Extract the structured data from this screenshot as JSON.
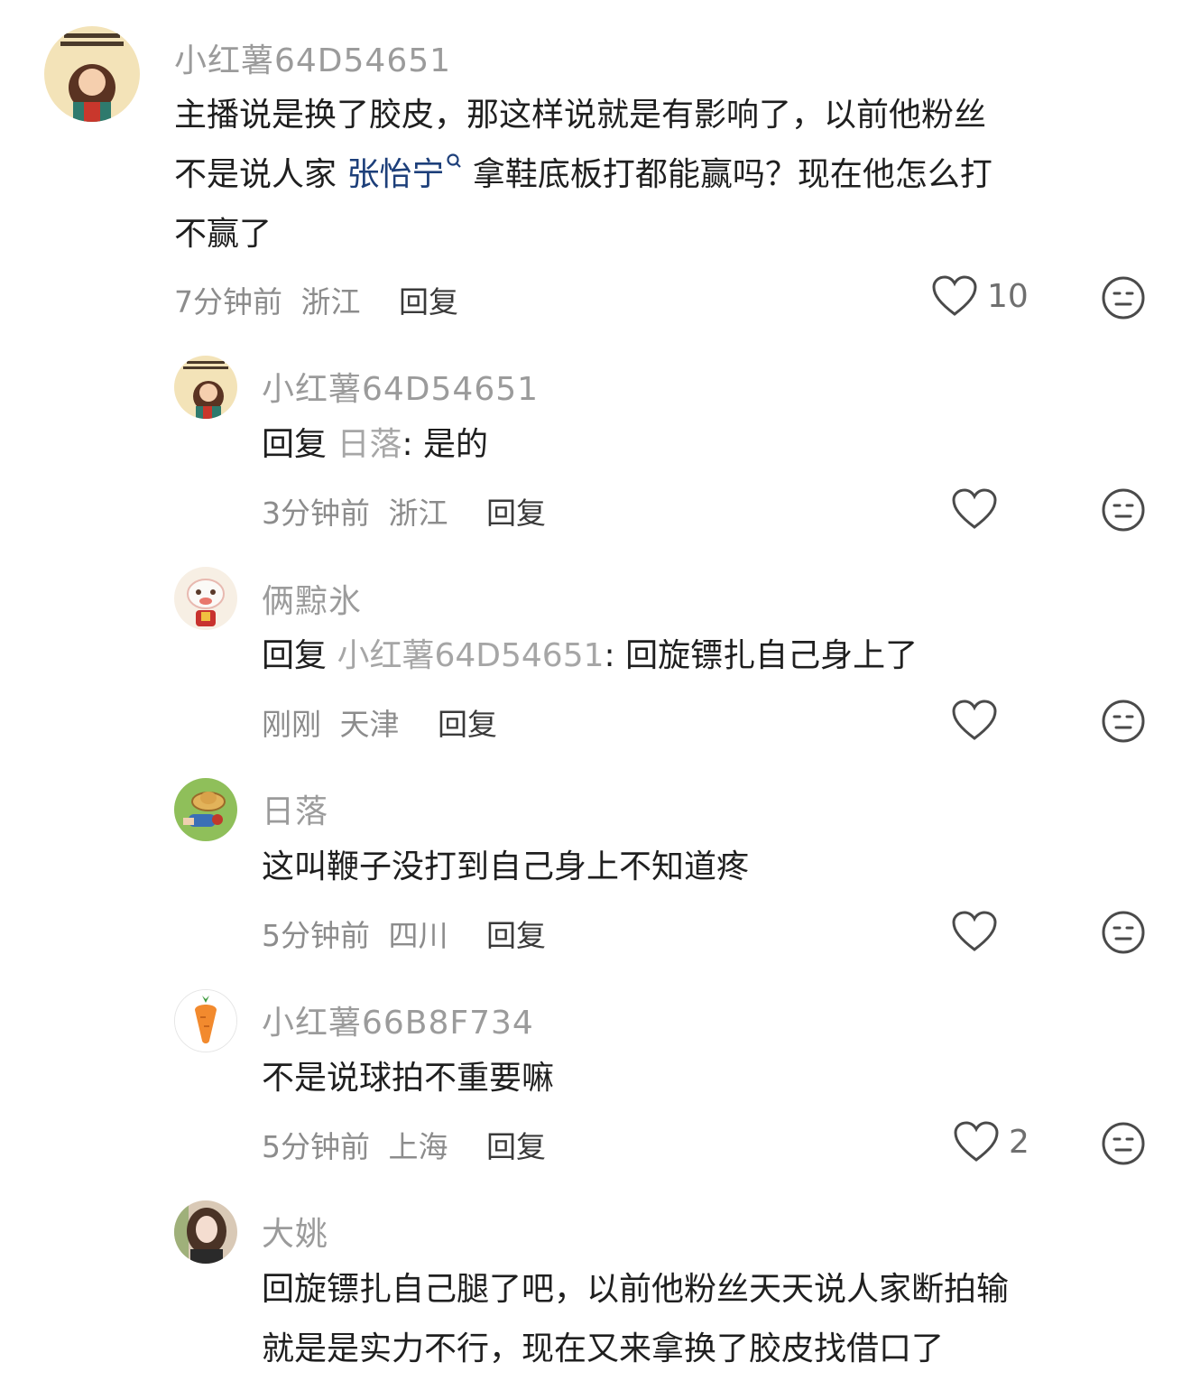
{
  "comments": [
    {
      "username": "小红薯64D54651",
      "text_lines": [
        "主播说是换了胶皮，那这样说就是有影响了，以前他粉丝",
        "不是说人家 ",
        "拿鞋底板打都能赢吗？现在他怎么打",
        "不赢了"
      ],
      "mention": "张怡宁",
      "time": "7分钟前",
      "location": "浙江",
      "reply_label": "回复",
      "likes": "10",
      "avatar_icon": "cartoon-girl-avatar"
    },
    {
      "username": "小红薯64D54651",
      "reply_prefix": "回复 ",
      "reply_to": "日落",
      "reply_text": ": 是的",
      "time": "3分钟前",
      "location": "浙江",
      "reply_label": "回复",
      "avatar_icon": "cartoon-girl-avatar"
    },
    {
      "username": "俩黥氷",
      "reply_prefix": "回复 ",
      "reply_to": "小红薯64D54651",
      "reply_text": ": 回旋镖扎自己身上了",
      "time": "刚刚",
      "location": "天津",
      "reply_label": "回复",
      "avatar_icon": "lion-dance-avatar"
    },
    {
      "username": "日落",
      "text": "这叫鞭子没打到自己身上不知道疼",
      "time": "5分钟前",
      "location": "四川",
      "reply_label": "回复",
      "avatar_icon": "straw-hat-avatar"
    },
    {
      "username": "小红薯66B8F734",
      "text": "不是说球拍不重要嘛",
      "time": "5分钟前",
      "location": "上海",
      "reply_label": "回复",
      "likes": "2",
      "avatar_icon": "carrot-avatar"
    },
    {
      "username": "大姚",
      "text_lines": [
        "回旋镖扎自己腿了吧，以前他粉丝天天说人家断拍输",
        "就是是实力不行，现在又来拿换了胶皮找借口了"
      ],
      "avatar_icon": "photo-girl-avatar"
    }
  ],
  "colors": {
    "name": "#9b9b9b",
    "mention": "#1d3f7a",
    "meta": "#8c8c8c"
  }
}
